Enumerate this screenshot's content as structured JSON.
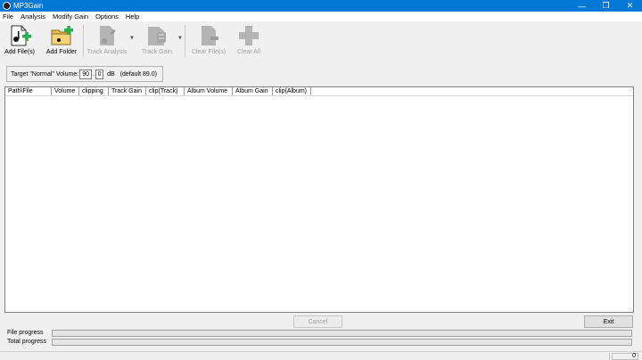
{
  "window": {
    "title": "MP3Gain"
  },
  "menu": [
    "File",
    "Analysis",
    "Modify Gain",
    "Options",
    "Help"
  ],
  "toolbar": {
    "add_files": "Add File(s)",
    "add_folder": "Add Folder",
    "track_analysis": "Track Analysis",
    "track_gain": "Track Gain",
    "clear_files": "Clear File(s)",
    "clear_all": "Clear All"
  },
  "target": {
    "label": "Target \"Normal\" Volume:",
    "integer": "90",
    "decimal": "0",
    "unit": "dB",
    "default": "(default 89.0)"
  },
  "columns": [
    "Path\\File",
    "Volume",
    "clipping",
    "Track Gain",
    "clip(Track)",
    "Album Volume",
    "Album Gain",
    "clip(Album)"
  ],
  "buttons": {
    "cancel": "Cancel",
    "exit": "Exit"
  },
  "progress": {
    "file_label": "File progress",
    "total_label": "Total progress"
  },
  "status": {
    "count": "0"
  },
  "colors": {
    "titlebar": "#0078d7",
    "add_green": "#22b14c"
  }
}
